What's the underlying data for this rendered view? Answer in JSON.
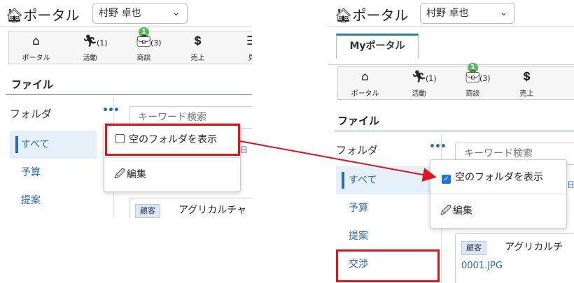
{
  "app": {
    "logo_text": "ポータル",
    "user_name": "村野 卓也"
  },
  "tabs": {
    "my_portal": "Myポータル"
  },
  "toolbar": [
    {
      "icon": "home-icon",
      "label": "ポータル",
      "count": ""
    },
    {
      "icon": "running-person-icon",
      "label": "活動",
      "count": "(1)"
    },
    {
      "icon": "briefcase-icon",
      "label": "商談",
      "count": "(3)",
      "badge": "1"
    },
    {
      "icon": "invoice-icon",
      "label": "売上",
      "count": ""
    },
    {
      "icon": "document-icon",
      "label": "見",
      "count": ""
    }
  ],
  "files": {
    "section_title": "ファイル",
    "folder_label": "フォルダ",
    "folder_menu_glyph": "•••",
    "search_placeholder": "キーワード検索",
    "folders_left": [
      "すべて",
      "予算",
      "提案"
    ],
    "folders_right": [
      "すべて",
      "予算",
      "提案",
      "交渉"
    ],
    "date_fragment": "日",
    "card": {
      "tag": "顧客",
      "title_left": "アグリカルチャ",
      "title_right": "アグリカルチ",
      "link": "0001.JPG"
    }
  },
  "folder_menu": {
    "show_empty_label": "空のフォルダを表示",
    "edit_label": "編集"
  },
  "before": {
    "show_empty_checked": false
  },
  "after": {
    "show_empty_checked": true
  },
  "colors": {
    "accent": "#2b6da6",
    "highlight": "#e1141c",
    "badge": "#5cb85c",
    "selected_bg": "#e6f0f8"
  }
}
